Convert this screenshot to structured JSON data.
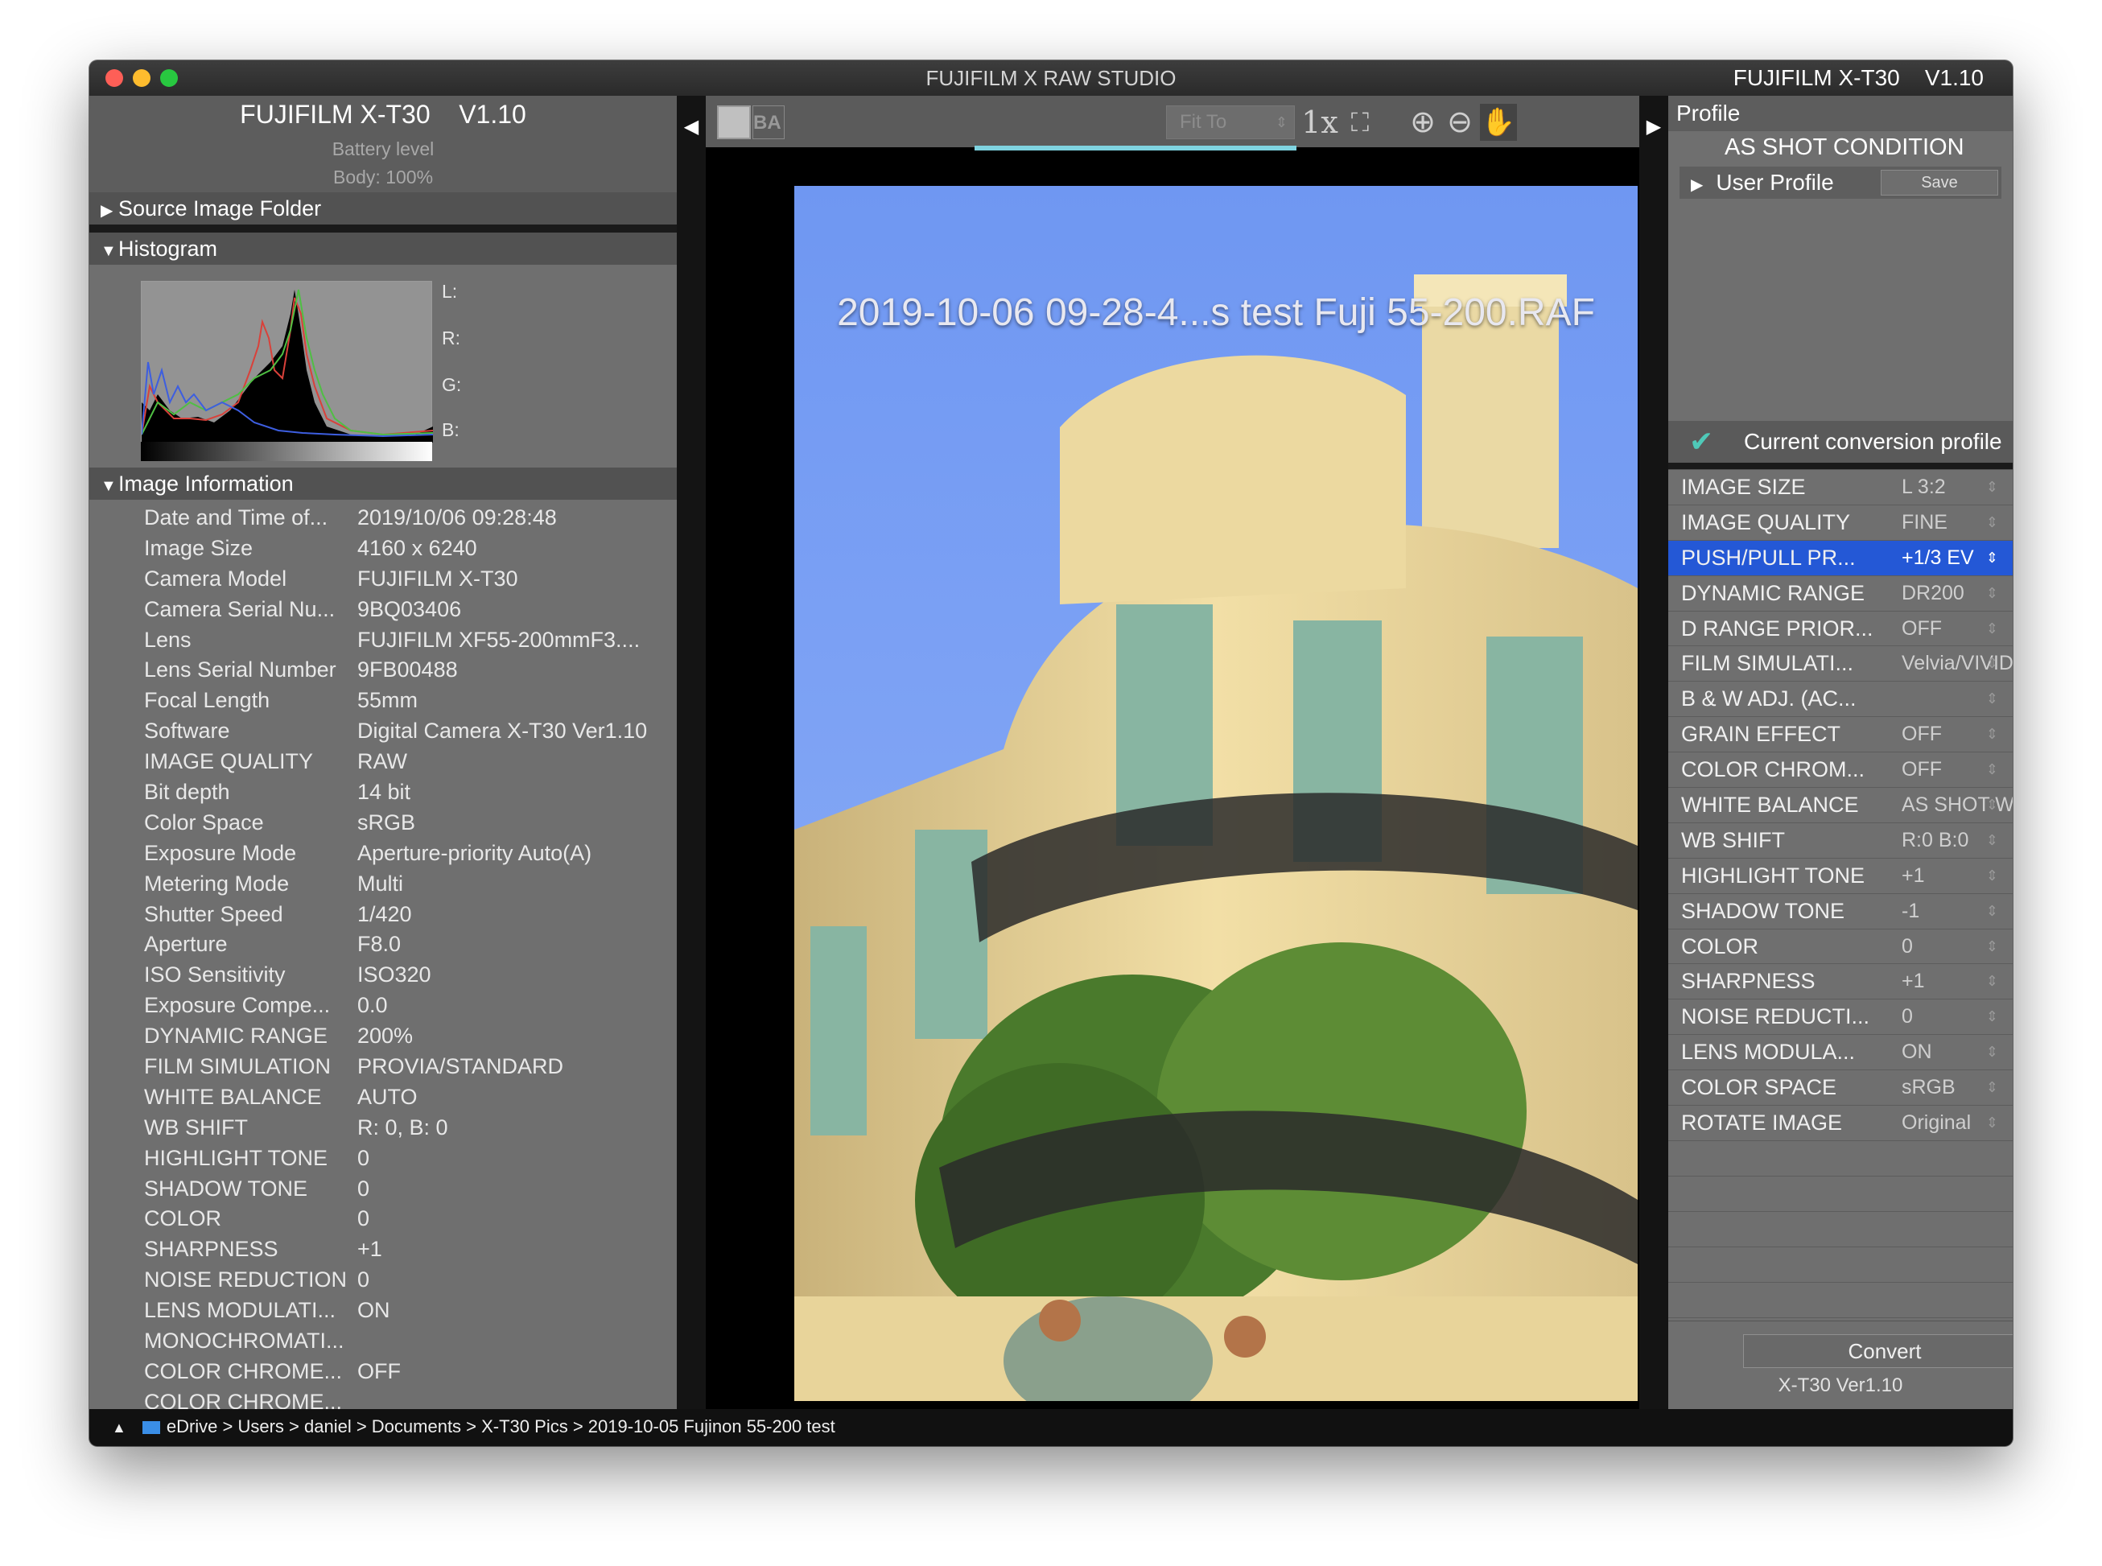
{
  "window": {
    "title": "FUJIFILM X RAW STUDIO",
    "title_right": "FUJIFILM X-T30    V1.10"
  },
  "left": {
    "camera_title": "FUJIFILM X-T30    V1.10",
    "battery": "Battery level",
    "body": "Body: 100%",
    "source_folder": "Source Image Folder",
    "histogram": "Histogram",
    "hist_labels": [
      "L:",
      "R:",
      "G:",
      "B:"
    ],
    "image_information": "Image Information",
    "rows": [
      {
        "k": "Date and Time of...",
        "v": "2019/10/06 09:28:48"
      },
      {
        "k": "Image Size",
        "v": "4160 x 6240"
      },
      {
        "k": "Camera Model",
        "v": "FUJIFILM X-T30"
      },
      {
        "k": "Camera Serial Nu...",
        "v": "9BQ03406"
      },
      {
        "k": "Lens",
        "v": "FUJIFILM XF55-200mmF3...."
      },
      {
        "k": "Lens Serial Number",
        "v": "9FB00488"
      },
      {
        "k": "Focal Length",
        "v": "55mm"
      },
      {
        "k": "Software",
        "v": "Digital Camera X-T30 Ver1.10"
      },
      {
        "k": "IMAGE QUALITY",
        "v": "RAW"
      },
      {
        "k": "Bit depth",
        "v": "14 bit"
      },
      {
        "k": "Color Space",
        "v": "sRGB"
      },
      {
        "k": "Exposure Mode",
        "v": "Aperture-priority Auto(A)"
      },
      {
        "k": "Metering Mode",
        "v": "Multi"
      },
      {
        "k": "Shutter Speed",
        "v": "1/420"
      },
      {
        "k": "Aperture",
        "v": "F8.0"
      },
      {
        "k": "ISO Sensitivity",
        "v": "ISO320"
      },
      {
        "k": "Exposure Compe...",
        "v": "0.0"
      },
      {
        "k": "DYNAMIC RANGE",
        "v": "200%"
      },
      {
        "k": "FILM SIMULATION",
        "v": "PROVIA/STANDARD"
      },
      {
        "k": "WHITE BALANCE",
        "v": "AUTO"
      },
      {
        "k": "WB SHIFT",
        "v": "R: 0, B: 0"
      },
      {
        "k": "HIGHLIGHT TONE",
        "v": "0"
      },
      {
        "k": "SHADOW TONE",
        "v": "0"
      },
      {
        "k": "COLOR",
        "v": "0"
      },
      {
        "k": "SHARPNESS",
        "v": "+1"
      },
      {
        "k": "NOISE REDUCTION",
        "v": "0"
      },
      {
        "k": "LENS MODULATI...",
        "v": "ON"
      },
      {
        "k": "MONOCHROMATI...",
        "v": ""
      },
      {
        "k": "COLOR CHROME...",
        "v": "OFF"
      },
      {
        "k": "COLOR CHROME...",
        "v": ""
      }
    ]
  },
  "center": {
    "fit_to": "Fit To",
    "ba_label": "BA",
    "zoom_1x": "1x",
    "photo_title": "2019-10-06 09-28-4...s test Fuji 55-200.RAF"
  },
  "right": {
    "profile": "Profile",
    "as_shot": "AS SHOT CONDITION",
    "user_profile": "User Profile",
    "save": "Save",
    "current_conversion": "Current conversion profile",
    "settings": [
      {
        "k": "IMAGE SIZE",
        "v": "L 3:2"
      },
      {
        "k": "IMAGE QUALITY",
        "v": "FINE"
      },
      {
        "k": "PUSH/PULL PR...",
        "v": "+1/3 EV"
      },
      {
        "k": "DYNAMIC RANGE",
        "v": "DR200"
      },
      {
        "k": "D RANGE PRIOR...",
        "v": "OFF"
      },
      {
        "k": "FILM SIMULATI...",
        "v": "Velvia/VIVID"
      },
      {
        "k": "B & W ADJ. (AC...",
        "v": ""
      },
      {
        "k": "GRAIN EFFECT",
        "v": "OFF"
      },
      {
        "k": "COLOR CHROM...",
        "v": "OFF"
      },
      {
        "k": "WHITE BALANCE",
        "v": "AS SHOT WB"
      },
      {
        "k": "WB SHIFT",
        "v": "R:0 B:0"
      },
      {
        "k": "HIGHLIGHT TONE",
        "v": "+1"
      },
      {
        "k": "SHADOW TONE",
        "v": "-1"
      },
      {
        "k": "COLOR",
        "v": "0"
      },
      {
        "k": "SHARPNESS",
        "v": "+1"
      },
      {
        "k": "NOISE REDUCTI...",
        "v": "0"
      },
      {
        "k": "LENS MODULA...",
        "v": "ON"
      },
      {
        "k": "COLOR SPACE",
        "v": "sRGB"
      },
      {
        "k": "ROTATE IMAGE",
        "v": "Original"
      }
    ],
    "selected_setting": "PUSH/PULL PR...",
    "convert": "Convert",
    "convert_sub": "X-T30 Ver1.10"
  },
  "statusbar": {
    "path": "eDrive > Users > daniel > Documents > X-T30 Pics > 2019-10-05 Fujinon 55-200 test"
  },
  "colors": {
    "selection": "#2458d6",
    "progress": "#7fd3e0",
    "check": "#4fc9b8"
  }
}
